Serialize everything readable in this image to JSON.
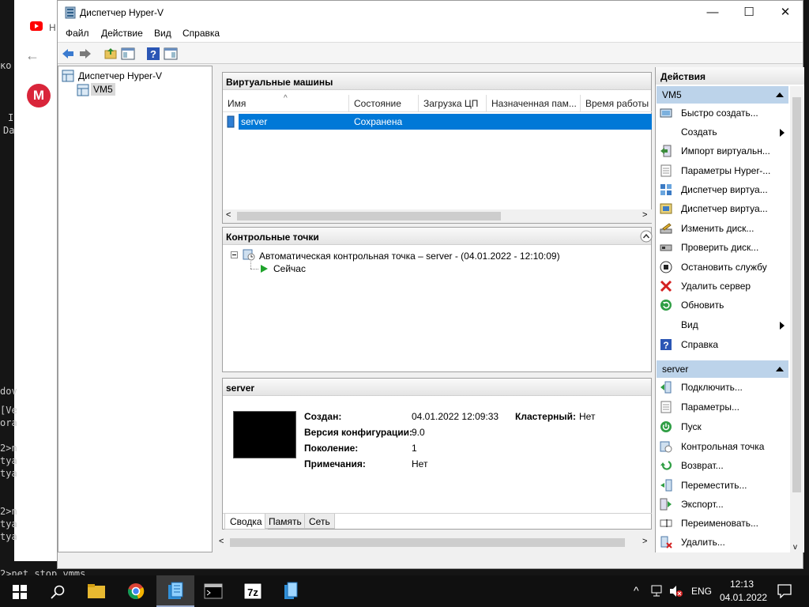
{
  "background": {
    "browser_tab_initial": "Н",
    "terminal_lines": [
      "ко",
      "I",
      "Da",
      "dov",
      "[Ve",
      "ora",
      "2>n",
      "tyа",
      "tyа",
      "2>n",
      "tyа",
      "tyа",
      "2>net stop vmms"
    ]
  },
  "window": {
    "title": "Диспетчер Hyper-V",
    "controls": {
      "minimize": "—",
      "maximize": "☐",
      "close": "✕"
    }
  },
  "menu": [
    "Файл",
    "Действие",
    "Вид",
    "Справка"
  ],
  "tree": {
    "root": "Диспетчер Hyper-V",
    "server": "VM5"
  },
  "vms": {
    "title": "Виртуальные машины",
    "columns": [
      "Имя",
      "Состояние",
      "Загрузка ЦП",
      "Назначенная пам...",
      "Время работы"
    ],
    "rows": [
      {
        "name": "server",
        "state": "Сохранена"
      }
    ]
  },
  "checkpoints": {
    "title": "Контрольные точки",
    "item": "Автоматическая контрольная точка – server - (04.01.2022 - 12:10:09)",
    "now": "Сейчас"
  },
  "details": {
    "title": "server",
    "created_label": "Создан:",
    "created_value": "04.01.2022 12:09:33",
    "clustered_label": "Кластерный:",
    "clustered_value": "Нет",
    "config_label": "Версия конфигурации:",
    "config_value": "9.0",
    "gen_label": "Поколение:",
    "gen_value": "1",
    "notes_label": "Примечания:",
    "notes_value": "Нет",
    "tabs": [
      "Сводка",
      "Память",
      "Сеть"
    ]
  },
  "actions": {
    "title": "Действия",
    "vm5_group": "VM5",
    "vm5_items": [
      "Быстро создать...",
      "Создать",
      "Импорт виртуальн...",
      "Параметры Hyper-...",
      "Диспетчер виртуа...",
      "Диспетчер виртуа...",
      "Изменить диск...",
      "Проверить диск...",
      "Остановить службу",
      "Удалить сервер",
      "Обновить",
      "Вид",
      "Справка"
    ],
    "server_group": "server",
    "server_items": [
      "Подключить...",
      "Параметры...",
      "Пуск",
      "Контрольная точка",
      "Возврат...",
      "Переместить...",
      "Экспорт...",
      "Переименовать...",
      "Удалить..."
    ]
  },
  "taskbar": {
    "lang": "ENG",
    "time": "12:13",
    "date": "04.01.2022"
  }
}
